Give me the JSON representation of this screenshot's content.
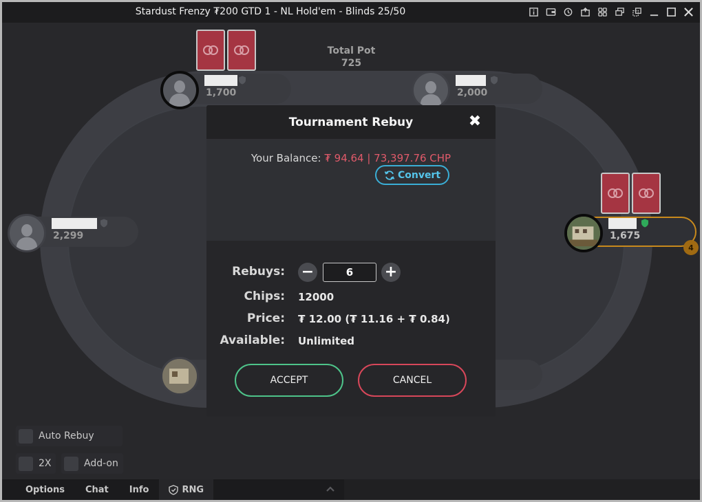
{
  "window": {
    "title": "Stardust Frenzy ₮200 GTD 1 - NL Hold'em - Blinds 25/50"
  },
  "table": {
    "pot_label": "Total Pot",
    "pot_value": "725",
    "seats": [
      {
        "stack": "1,700"
      },
      {
        "stack": "2,000"
      },
      {
        "stack": "2,299"
      },
      {
        "stack": "1,675",
        "badge": "4"
      }
    ]
  },
  "dialog": {
    "title": "Tournament Rebuy",
    "close_glyph": "✖",
    "balance_label": "Your Balance:",
    "balance_value": "₮ 94.64 | 73,397.76 CHP",
    "convert_label": "Convert",
    "rebuys_label": "Rebuys:",
    "rebuys_value": "6",
    "minus_glyph": "−",
    "plus_glyph": "+",
    "chips_label": "Chips:",
    "chips_value": "12000",
    "price_label": "Price:",
    "price_value": "₮ 12.00 (₮ 11.16 + ₮ 0.84)",
    "available_label": "Available:",
    "available_value": "Unlimited",
    "accept_label": "ACCEPT",
    "cancel_label": "CANCEL"
  },
  "options": {
    "auto_rebuy_label": "Auto Rebuy",
    "double_label": "2X",
    "addon_label": "Add-on"
  },
  "bottom_bar": {
    "options_label": "Options",
    "chat_label": "Chat",
    "info_label": "Info",
    "rng_label": "RNG"
  },
  "colors": {
    "accent_accept": "#4ec48a",
    "accent_cancel": "#d8475a",
    "balance_red": "#e05a6a",
    "convert_blue": "#3aaed6",
    "hero_ring": "#c98a1c",
    "card_back": "#a53542"
  },
  "icons": [
    "info-icon",
    "wallet-icon",
    "history-icon",
    "lobby-icon",
    "tables-grid-icon",
    "tile-windows-icon",
    "restore-layout-icon",
    "minimize-icon",
    "maximize-icon",
    "close-icon",
    "shield-icon",
    "refresh-icon",
    "chevron-up-icon"
  ]
}
